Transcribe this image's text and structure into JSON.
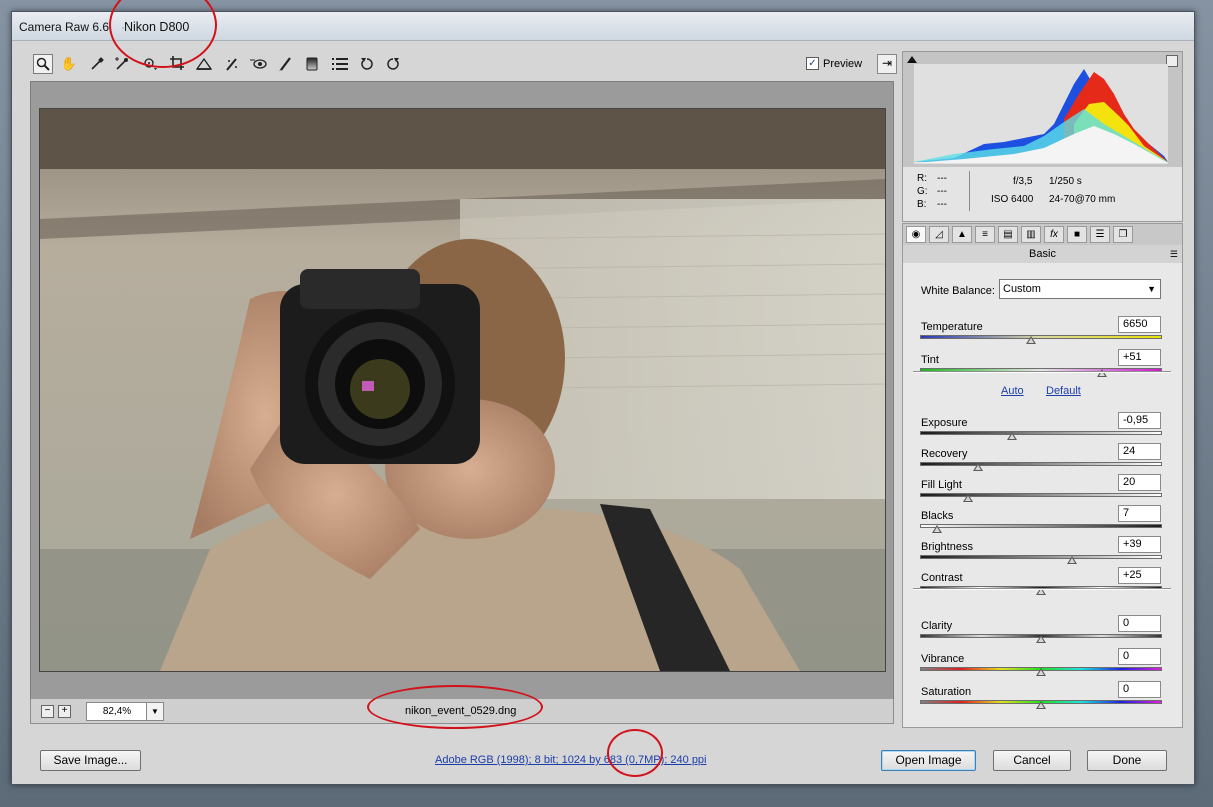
{
  "window": {
    "app_title": "Camera Raw 6.6",
    "camera": "Nikon D800"
  },
  "toolbar": {
    "tools": [
      "zoom-icon",
      "hand-icon",
      "white-balance-icon",
      "color-sampler-icon",
      "target-adjust-icon",
      "crop-icon",
      "straighten-icon",
      "spot-removal-icon",
      "red-eye-icon",
      "adjustment-brush-icon",
      "graduated-filter-icon",
      "preferences-icon",
      "rotate-ccw-icon",
      "rotate-cw-icon"
    ],
    "preview_label": "Preview",
    "preview_checked": "✓"
  },
  "status": {
    "zoom_value": "82,4%",
    "filename": "nikon_event_0529.dng"
  },
  "info": {
    "r_label": "R:",
    "g_label": "G:",
    "b_label": "B:",
    "r_val": "---",
    "g_val": "---",
    "b_val": "---",
    "aperture": "f/3,5",
    "shutter": "1/250 s",
    "iso": "ISO 6400",
    "lens": "24-70@70 mm"
  },
  "panel": {
    "title": "Basic",
    "tabs": [
      "basic-tab",
      "tone-curve-tab",
      "detail-tab",
      "hsl-tab",
      "split-toning-tab",
      "lens-corrections-tab",
      "effects-tab",
      "camera-calibration-tab",
      "presets-tab",
      "snapshots-tab"
    ],
    "white_balance_label": "White Balance:",
    "white_balance_value": "Custom",
    "auto_label": "Auto",
    "default_label": "Default",
    "sliders": [
      {
        "label": "Temperature",
        "value": "6650",
        "pos": 0.46
      },
      {
        "label": "Tint",
        "value": "+51",
        "pos": 0.75
      },
      {
        "label": "Exposure",
        "value": "-0,95",
        "pos": 0.38
      },
      {
        "label": "Recovery",
        "value": "24",
        "pos": 0.24
      },
      {
        "label": "Fill Light",
        "value": "20",
        "pos": 0.2
      },
      {
        "label": "Blacks",
        "value": "7",
        "pos": 0.07
      },
      {
        "label": "Brightness",
        "value": "+39",
        "pos": 0.63
      },
      {
        "label": "Contrast",
        "value": "+25",
        "pos": 0.5
      },
      {
        "label": "Clarity",
        "value": "0",
        "pos": 0.5
      },
      {
        "label": "Vibrance",
        "value": "0",
        "pos": 0.5
      },
      {
        "label": "Saturation",
        "value": "0",
        "pos": 0.5
      }
    ]
  },
  "footer": {
    "save_label": "Save Image...",
    "image_info": "Adobe RGB (1998); 8 bit; 1024 by 683 (0,7MP); 240 ppi",
    "open_label": "Open Image",
    "cancel_label": "Cancel",
    "done_label": "Done"
  },
  "colors": {
    "accent": "#1d3ea8",
    "annotation": "#d2121a"
  }
}
